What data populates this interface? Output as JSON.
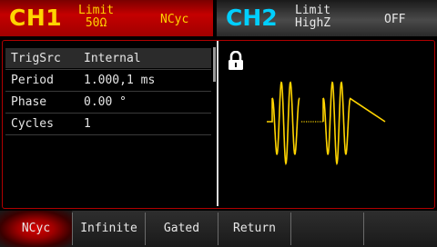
{
  "ch1": {
    "name": "CH1",
    "limit_label": "Limit",
    "limit_value": "50Ω",
    "mode": "NCyc"
  },
  "ch2": {
    "name": "CH2",
    "limit_label": "Limit",
    "limit_value": "HighZ",
    "state": "OFF"
  },
  "params": [
    {
      "name": "TrigSrc",
      "value": "Internal"
    },
    {
      "name": "Period",
      "value": "1.000,1 ms"
    },
    {
      "name": "Phase",
      "value": "0.00 °"
    },
    {
      "name": "Cycles",
      "value": "1"
    }
  ],
  "softkeys": [
    {
      "label": "NCyc"
    },
    {
      "label": "Infinite"
    },
    {
      "label": "Gated"
    },
    {
      "label": "Return"
    },
    {
      "label": ""
    },
    {
      "label": ""
    }
  ],
  "colors": {
    "ch1_accent": "#ffd400",
    "ch2_accent": "#00cfff",
    "frame_red": "#b00000",
    "waveform": "#ffd400"
  }
}
